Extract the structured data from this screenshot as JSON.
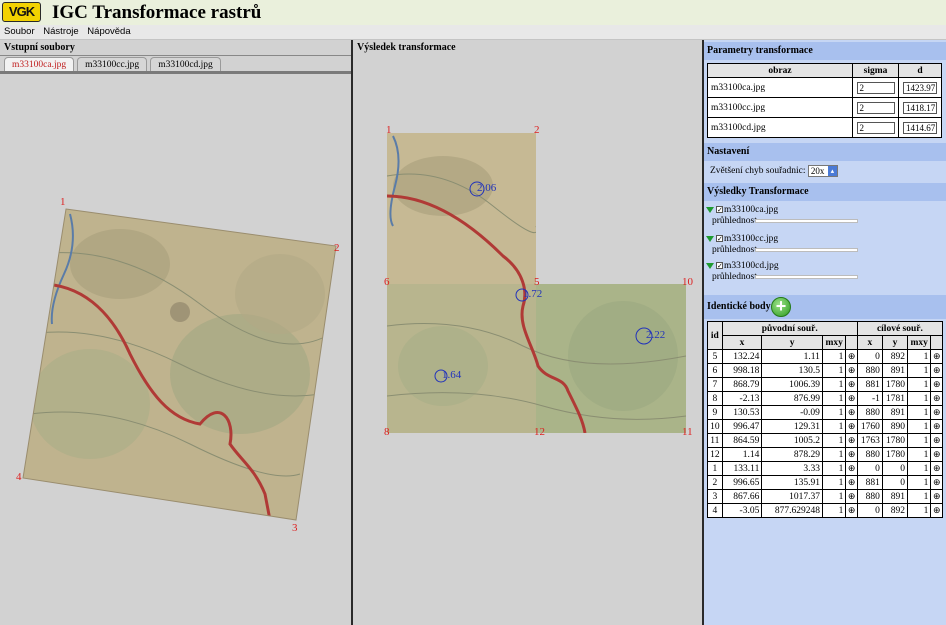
{
  "app": {
    "title": "IGC Transformace rastrů",
    "logo_text": "VGK"
  },
  "menu": [
    "Soubor",
    "Nástroje",
    "Nápověda"
  ],
  "left_panel": {
    "title": "Vstupní soubory",
    "tabs": [
      {
        "label": "m33100ca.jpg",
        "active": true
      },
      {
        "label": "m33100cc.jpg",
        "active": false
      },
      {
        "label": "m33100cd.jpg",
        "active": false
      }
    ],
    "corner_labels": [
      "1",
      "2",
      "3",
      "4"
    ]
  },
  "mid_panel": {
    "title": "Výsledek transformace",
    "corner_labels": [
      "1",
      "2",
      "5",
      "6",
      "10",
      "8",
      "12",
      "11"
    ],
    "error_labels": [
      "2.06",
      "1.72",
      "2.22",
      "1.64"
    ]
  },
  "params": {
    "title": "Parametry transformace",
    "headers": [
      "obraz",
      "sigma",
      "d"
    ],
    "rows": [
      {
        "image": "m33100ca.jpg",
        "sigma": "2",
        "d": "1423.97"
      },
      {
        "image": "m33100cc.jpg",
        "sigma": "2",
        "d": "1418.17"
      },
      {
        "image": "m33100cd.jpg",
        "sigma": "2",
        "d": "1414.67"
      }
    ]
  },
  "settings": {
    "title": "Nastavení",
    "zoom_label": "Zvětšení chyb souřadnic:",
    "zoom_value": "20x"
  },
  "results": {
    "title": "Výsledky Transformace",
    "opacity_label": "průhlednost",
    "items": [
      "m33100ca.jpg",
      "m33100cc.jpg",
      "m33100cd.jpg"
    ]
  },
  "points": {
    "title": "Identické body",
    "group_source": "původní souř.",
    "group_target": "cílové souř.",
    "col_id": "id",
    "col_x": "x",
    "col_y": "y",
    "col_mxy": "mxy",
    "rows": [
      {
        "id": "5",
        "sx": "132.24",
        "sy": "1.11",
        "smxy": "1",
        "tx": "0",
        "ty": "892",
        "tmxy": "1"
      },
      {
        "id": "6",
        "sx": "998.18",
        "sy": "130.5",
        "smxy": "1",
        "tx": "880",
        "ty": "891",
        "tmxy": "1"
      },
      {
        "id": "7",
        "sx": "868.79",
        "sy": "1006.39",
        "smxy": "1",
        "tx": "881",
        "ty": "1780",
        "tmxy": "1"
      },
      {
        "id": "8",
        "sx": "-2.13",
        "sy": "876.99",
        "smxy": "1",
        "tx": "-1",
        "ty": "1781",
        "tmxy": "1"
      },
      {
        "id": "9",
        "sx": "130.53",
        "sy": "-0.09",
        "smxy": "1",
        "tx": "880",
        "ty": "891",
        "tmxy": "1"
      },
      {
        "id": "10",
        "sx": "996.47",
        "sy": "129.31",
        "smxy": "1",
        "tx": "1760",
        "ty": "890",
        "tmxy": "1"
      },
      {
        "id": "11",
        "sx": "864.59",
        "sy": "1005.2",
        "smxy": "1",
        "tx": "1763",
        "ty": "1780",
        "tmxy": "1"
      },
      {
        "id": "12",
        "sx": "1.14",
        "sy": "878.29",
        "smxy": "1",
        "tx": "880",
        "ty": "1780",
        "tmxy": "1"
      },
      {
        "id": "1",
        "sx": "133.11",
        "sy": "3.33",
        "smxy": "1",
        "tx": "0",
        "ty": "0",
        "tmxy": "1"
      },
      {
        "id": "2",
        "sx": "996.65",
        "sy": "135.91",
        "smxy": "1",
        "tx": "881",
        "ty": "0",
        "tmxy": "1"
      },
      {
        "id": "3",
        "sx": "867.66",
        "sy": "1017.37",
        "smxy": "1",
        "tx": "880",
        "ty": "891",
        "tmxy": "1"
      },
      {
        "id": "4",
        "sx": "-3.05",
        "sy": "877.629248",
        "smxy": "1",
        "tx": "0",
        "ty": "892",
        "tmxy": "1"
      }
    ]
  },
  "colors": {
    "header_bg": "#eaf0dc",
    "panel_bg": "#d2d2d2",
    "sidebar_bg": "#c6d6f4",
    "section_bg": "#a8c0ee",
    "map_paper": "#c7b896",
    "marker_red": "#dd2020",
    "marker_blue": "#2233bb",
    "road_red": "#b03a36"
  }
}
